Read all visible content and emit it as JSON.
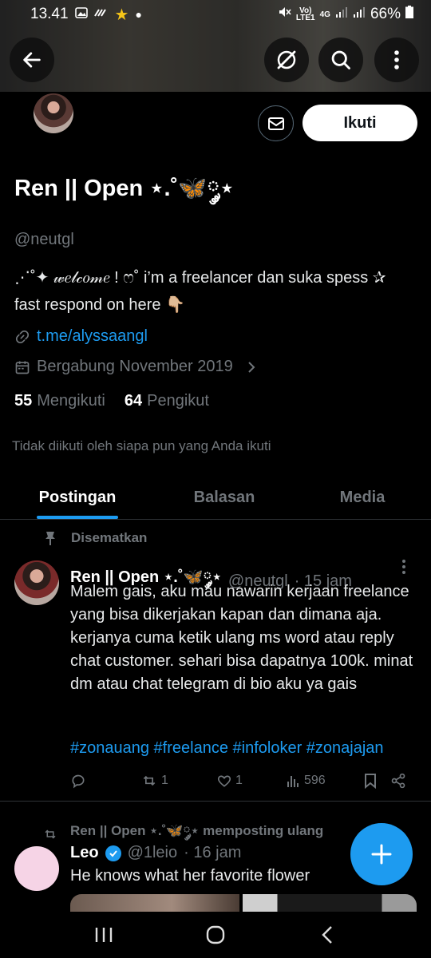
{
  "status_bar": {
    "time": "13.41",
    "battery": "66%",
    "network_top": "Vo)",
    "network_bottom": "LTE1",
    "network_type": "4G"
  },
  "profile": {
    "display_name": "Ren || Open ⋆.˚🦋༘⋆",
    "handle": "@neutgl",
    "bio_line1": "⋰˚✦ 𝓌𝑒𝓁𝒸𝑜𝓂𝑒 ! ෆ˚ i’m a freelancer dan suka spess ✰",
    "bio_line2": "fast respond on here 👇🏼",
    "link": "t.me/alyssaangl",
    "joined": "Bergabung November 2019",
    "following_count": "55",
    "following_label": "Mengikuti",
    "followers_count": "64",
    "followers_label": "Pengikut",
    "not_followed_text": "Tidak diikuti oleh siapa pun yang Anda ikuti",
    "follow_button": "Ikuti"
  },
  "tabs": [
    {
      "label": "Postingan",
      "active": true
    },
    {
      "label": "Balasan",
      "active": false
    },
    {
      "label": "Media",
      "active": false
    }
  ],
  "pinned_post": {
    "pinned_label": "Disematkan",
    "author": "Ren || Open ⋆.˚🦋༘⋆",
    "handle": "@neutgl",
    "time": "· 15 jam",
    "text": "Malem gais, aku mau nawarin kerjaan freelance yang bisa dikerjakan kapan dan dimana aja. kerjanya cuma ketik ulang ms word atau reply chat customer. sehari bisa dapatnya 100k. minat dm atau chat telegram di bio aku ya gais",
    "hashtags": [
      "#zonauang",
      "#freelance",
      "#infoloker",
      "#zonajajan"
    ],
    "reposts": "1",
    "likes": "1",
    "views": "596"
  },
  "repost": {
    "label": "Ren || Open ⋆.˚🦋༘⋆ memposting ulang",
    "author": "Leo",
    "handle": "@1leio",
    "time": "· 16 jam",
    "text": "He knows what her favorite flower"
  },
  "colors": {
    "accent": "#1d9bf0",
    "muted": "#71767b",
    "background": "#000000"
  }
}
